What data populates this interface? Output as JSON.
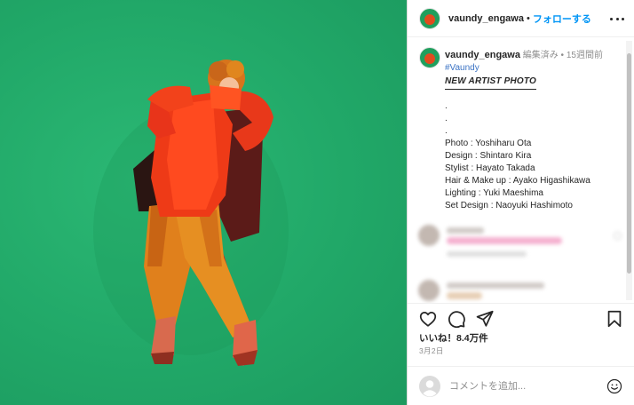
{
  "post": {
    "username": "vaundy_engawa",
    "separator": "•",
    "follow_label": "フォローする",
    "more_icon": "more-horizontal-icon"
  },
  "caption": {
    "username": "vaundy_engawa",
    "edited": "編集済み",
    "separator": "•",
    "time_ago": "15週間前",
    "hashtag": "#Vaundy",
    "headline": "NEW ARTIST PHOTO",
    "dots": [
      ".",
      ".",
      "."
    ],
    "credits": [
      "Photo : Yoshiharu Ota",
      "Design : Shintaro Kira",
      "Stylist : Hayato Takada",
      "Hair & Make up : Ayako Higashikawa",
      "Lighting : Yuki Maeshima",
      "Set Design : Naoyuki Hashimoto"
    ]
  },
  "actions": {
    "icons": [
      "heart-icon",
      "comment-icon",
      "share-icon",
      "save-icon"
    ],
    "likes": "いいね！8.4万件",
    "date": "3月2日"
  },
  "composer": {
    "placeholder": "コメントを追加...",
    "emoji_icon": "emoji-icon"
  },
  "colors": {
    "background_green": "#21a868",
    "link_blue": "#0095f6",
    "hashtag_blue": "#3b73c4",
    "text": "#262626",
    "muted": "#8e8e8e"
  }
}
